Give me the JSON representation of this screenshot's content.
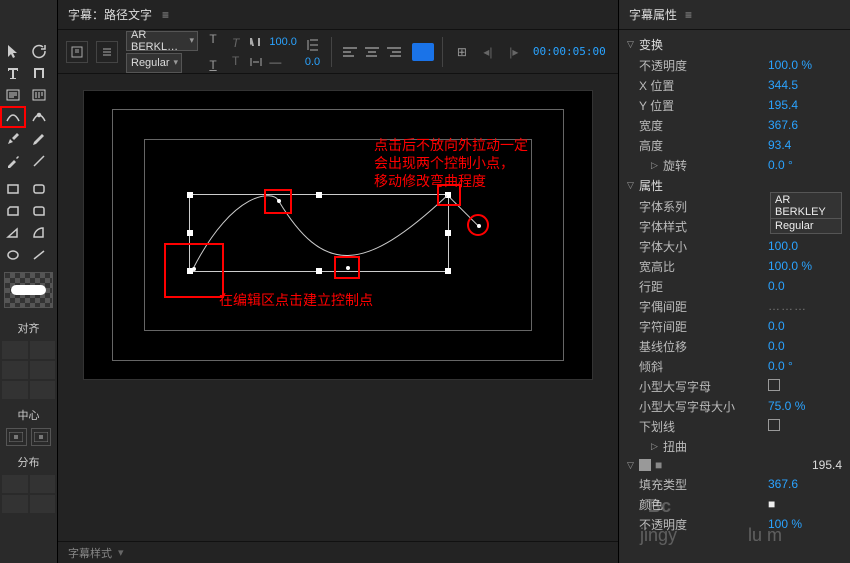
{
  "title": {
    "text": "字幕：路径文字",
    "menu_icon": "≡"
  },
  "optbar": {
    "font": "AR BERKL…",
    "style": "Regular",
    "size": "100.0",
    "leading": "0.0",
    "timecode": "00:00:05:00"
  },
  "canvas": {
    "anno1_l1": "点击后不放向外拉动一定",
    "anno1_l2": "会出现两个控制小点，",
    "anno1_l3": "移动修改弯曲程度",
    "anno2": "在编辑区点击建立控制点"
  },
  "bottom": {
    "label": "字幕样式"
  },
  "toolbar_labels": {
    "align": "对齐",
    "center": "中心",
    "distribute": "分布"
  },
  "rpanel": {
    "title": "字幕属性",
    "menu_icon": "≡",
    "sections": {
      "transform": "变换",
      "properties": "属性",
      "distort": "扭曲"
    },
    "props": [
      {
        "label": "不透明度",
        "value": "100.0 %"
      },
      {
        "label": "X 位置",
        "value": "344.5"
      },
      {
        "label": "Y 位置",
        "value": "195.4"
      },
      {
        "label": "宽度",
        "value": "367.6"
      },
      {
        "label": "高度",
        "value": "93.4"
      },
      {
        "label": "旋转",
        "value": "0.0 °",
        "indent": true
      },
      {
        "label": "字体系列",
        "value": "AR BERKLEY",
        "dd": true
      },
      {
        "label": "字体样式",
        "value": "Regular",
        "dd": true
      },
      {
        "label": "字体大小",
        "value": "100.0"
      },
      {
        "label": "宽高比",
        "value": "100.0 %"
      },
      {
        "label": "行距",
        "value": "0.0"
      },
      {
        "label": "字偶间距",
        "value": "………",
        "dash": true
      },
      {
        "label": "字符间距",
        "value": "0.0"
      },
      {
        "label": "基线位移",
        "value": "0.0"
      },
      {
        "label": "倾斜",
        "value": "0.0 °"
      },
      {
        "label": "小型大写字母",
        "cb": true
      },
      {
        "label": "小型大写字母大小",
        "value": "75.0 %"
      },
      {
        "label": "下划线",
        "cb": true
      },
      {
        "label": "填充类型",
        "value": "367.6",
        "right2": "195.4"
      },
      {
        "label": "颜色",
        "watermark": "jingy"
      },
      {
        "label": "不透明度",
        "value": "100 %"
      }
    ]
  },
  "watermarks": {
    "right": "lu       m"
  },
  "chart_data": null
}
